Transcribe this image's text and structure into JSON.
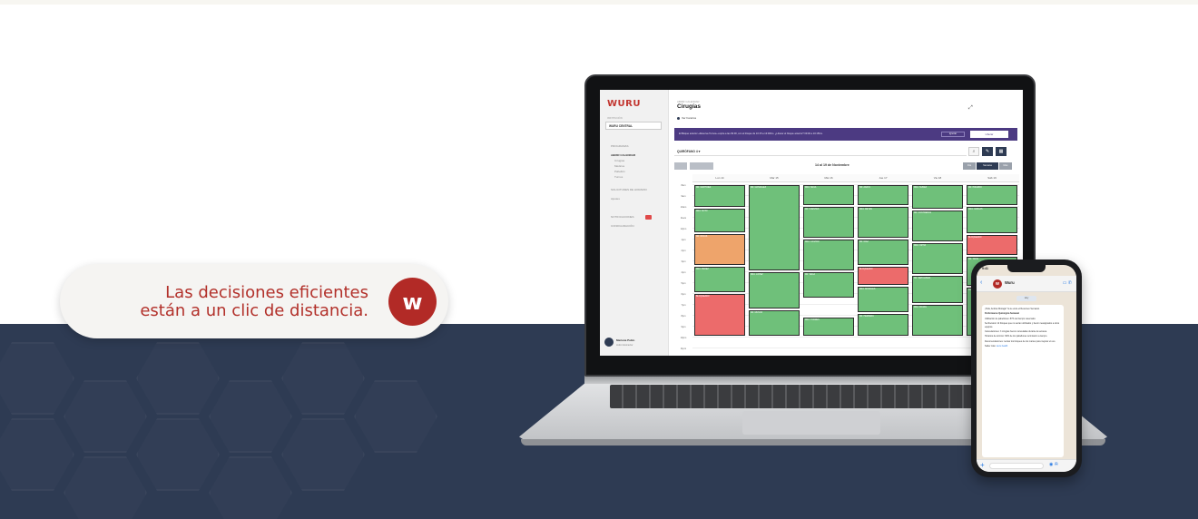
{
  "hero": {
    "tagline_line1": "Las decisiones eficientes",
    "tagline_line2": "están a un clic de distancia.",
    "logo_letter": "w"
  },
  "app": {
    "brand": "WURU",
    "sidebar": {
      "org_label": "INSTITUCIÓN",
      "org_value": "WURU CENTRAL",
      "items": [
        {
          "label": "PROGRAMAS"
        },
        {
          "label": "ABRIR CALENDAR"
        },
        {
          "label": "Cirugías"
        },
        {
          "label": "Médicos"
        },
        {
          "label": "Pabellón"
        },
        {
          "label": "Turnos"
        },
        {
          "label": "SOLICITUDES DE HORARIO"
        },
        {
          "label": "Ajustes"
        },
        {
          "label": "NOTIFICACIONES"
        },
        {
          "label": "CONFIGURACIÓN"
        }
      ],
      "user_name": "Mariana Pablo",
      "user_role": "Administrador"
    },
    "header": {
      "breadcrumb": "ABRIR CALENDAR",
      "title": "Cirugías",
      "link": "Ver horarios"
    },
    "banner": {
      "text": "El Bloque anterior «Reserva Turnos» expira a las 09:00, con el bloque de 10:15 a 13:00hrs. ¿Liberar el bloque anterior? 09:00 a 10:15hrs.",
      "secondary": "Ignorar",
      "primary": "Liberar"
    },
    "toolbar": {
      "selector": "QUIRÓFANO 4",
      "search_icon": "search-icon",
      "settings_icon": "filter-icon",
      "add_icon": "calendar-icon"
    },
    "calendar": {
      "week_title": "14 al 19 de Noviembre",
      "views": [
        "Día",
        "Semana",
        "Mes"
      ],
      "active_view": "Semana",
      "days": [
        "Lun 14",
        "Mar 15",
        "Mié 16",
        "Jue 17",
        "Vie 18",
        "Sáb 19"
      ],
      "times": [
        "8am",
        "9am",
        "10am",
        "11am",
        "12pm",
        "1pm",
        "2pm",
        "3pm",
        "4pm",
        "5pm",
        "6pm",
        "7pm",
        "8pm",
        "9pm",
        "10pm",
        "11pm"
      ],
      "events": [
        {
          "day": 0,
          "start": 0.0,
          "span": 2.2,
          "color": "g",
          "label": "DR. MARTÍNEZ"
        },
        {
          "day": 0,
          "start": 2.2,
          "span": 2.3,
          "color": "g",
          "label": "DRA. SOTO"
        },
        {
          "day": 0,
          "start": 4.5,
          "span": 3.0,
          "color": "o",
          "label": "DR. ROJAS"
        },
        {
          "day": 0,
          "start": 7.5,
          "span": 2.5,
          "color": "g",
          "label": "DRA. PÉREZ"
        },
        {
          "day": 0,
          "start": 10.0,
          "span": 4.0,
          "color": "r",
          "label": "BLOQUEADO"
        },
        {
          "day": 1,
          "start": 0.0,
          "span": 8.0,
          "color": "g",
          "label": "DR. GONZÁLEZ"
        },
        {
          "day": 1,
          "start": 8.0,
          "span": 3.5,
          "color": "g",
          "label": "DRA. LÓPEZ"
        },
        {
          "day": 1,
          "start": 11.5,
          "span": 2.5,
          "color": "g",
          "label": "DR. MUÑOZ"
        },
        {
          "day": 2,
          "start": 0.0,
          "span": 2.0,
          "color": "g",
          "label": "DRA. SILVA"
        },
        {
          "day": 2,
          "start": 2.0,
          "span": 3.0,
          "color": "g",
          "label": "DR. FUENTES"
        },
        {
          "day": 2,
          "start": 5.0,
          "span": 3.0,
          "color": "g",
          "label": "DRA. CASTRO"
        },
        {
          "day": 2,
          "start": 8.0,
          "span": 2.5,
          "color": "g",
          "label": "DR. VEGA"
        },
        {
          "day": 2,
          "start": 12.2,
          "span": 1.8,
          "color": "g",
          "label": "DRA. TORRES"
        },
        {
          "day": 3,
          "start": 0.0,
          "span": 2.0,
          "color": "g",
          "label": "DR. ARAYA"
        },
        {
          "day": 3,
          "start": 2.0,
          "span": 3.0,
          "color": "g",
          "label": "DRA. REYES"
        },
        {
          "day": 3,
          "start": 5.0,
          "span": 2.5,
          "color": "g",
          "label": "DR. DÍAZ"
        },
        {
          "day": 3,
          "start": 7.5,
          "span": 1.8,
          "color": "r",
          "label": "BLOQUEADO"
        },
        {
          "day": 3,
          "start": 9.3,
          "span": 2.5,
          "color": "g",
          "label": "DRA. MORALES"
        },
        {
          "day": 3,
          "start": 11.8,
          "span": 2.2,
          "color": "g",
          "label": "DR. HERRERA"
        },
        {
          "day": 4,
          "start": 0.0,
          "span": 2.3,
          "color": "g",
          "label": "DRA. NÚÑEZ"
        },
        {
          "day": 4,
          "start": 2.3,
          "span": 3.0,
          "color": "g",
          "label": "DR. CONTRERAS"
        },
        {
          "day": 4,
          "start": 5.3,
          "span": 3.0,
          "color": "g",
          "label": "DRA. ORTIZ"
        },
        {
          "day": 4,
          "start": 8.3,
          "span": 2.7,
          "color": "g",
          "label": "DR. SEPÚLVEDA"
        },
        {
          "day": 4,
          "start": 11.0,
          "span": 3.0,
          "color": "g",
          "label": "DRA. ROJAS"
        },
        {
          "day": 5,
          "start": 0.0,
          "span": 2.0,
          "color": "g",
          "label": "DR. PIZARRO"
        },
        {
          "day": 5,
          "start": 2.0,
          "span": 2.6,
          "color": "g",
          "label": "DRA. VARGAS"
        },
        {
          "day": 5,
          "start": 4.6,
          "span": 2.0,
          "color": "r",
          "label": "BLOQUEADO"
        },
        {
          "day": 5,
          "start": 6.6,
          "span": 2.8,
          "color": "g",
          "label": "DR. TAPIA"
        },
        {
          "day": 5,
          "start": 9.4,
          "span": 4.6,
          "color": "g",
          "label": "DRA. BRAVO"
        }
      ]
    }
  },
  "phone": {
    "status_time": "9:41",
    "contact": "Wuru",
    "date_chip": "Hoy",
    "message": [
      {
        "text": "¡Hola, Andrés Moraga! Ya te envié el Resumen Semanal.",
        "bold": false
      },
      {
        "text": "Performance Quirúrgica Semanal",
        "bold": true
      },
      {
        "text": "Utilización de pabellones: 87% del tiempo reservado.",
        "bold": false
      },
      {
        "text": "Se liberaron 12 bloques que no serían utilizados y fueron reasignados a otros equipos.",
        "bold": false
      },
      {
        "text": "Cancelaciones: 3 cirugías fueron canceladas durante la semana.",
        "bold": false
      },
      {
        "text": "Horarios de término: 90% de los pabellones terminaron a tiempo.",
        "bold": false
      },
      {
        "text": "Recomendaciones: revisar los bloques de los martes para mejorar el uso.",
        "bold": false
      },
      {
        "text": "Saber más:",
        "bold": false,
        "link": "wuru.health"
      }
    ]
  },
  "colors": {
    "navy": "#2e3b53",
    "brand_red": "#b22a26",
    "event_green": "#6fc07a",
    "event_orange": "#eea46b",
    "event_red": "#ec6b6b",
    "banner_purple": "#4c3a82"
  }
}
